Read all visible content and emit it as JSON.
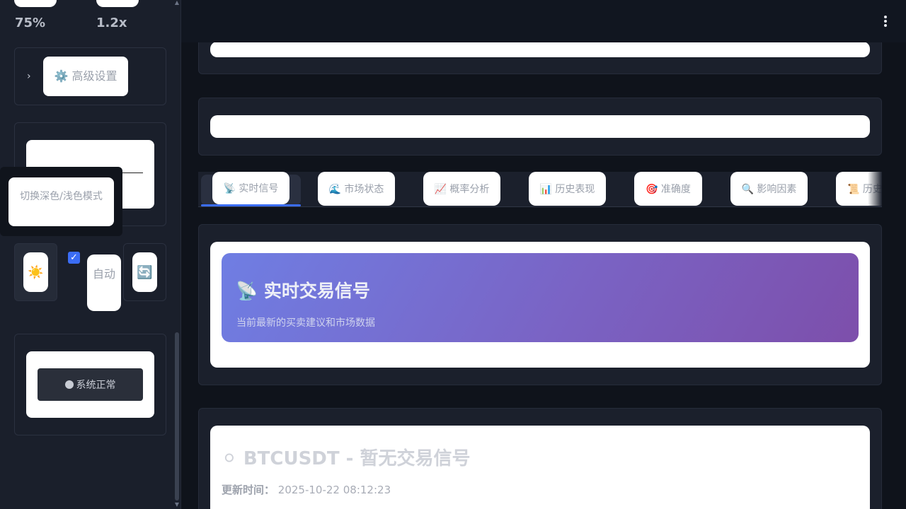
{
  "sidebar": {
    "metrics": [
      {
        "value": "75%"
      },
      {
        "value": "1.2x"
      }
    ],
    "advanced_settings": {
      "icon": "gear-icon",
      "label": "⚙️ 高级设置"
    },
    "theme_toggle": {
      "tooltip": "切换深色/浅色模式",
      "icon": "☀️"
    },
    "auto_refresh": {
      "checked": true,
      "label": "自动",
      "refresh_icon": "🔄"
    },
    "system_status": {
      "label": "系统正常",
      "dot_color": "#c8ccd4"
    }
  },
  "tabs": [
    {
      "label": "📡 实时信号",
      "active": true
    },
    {
      "label": "🌊 市场状态"
    },
    {
      "label": "📈 概率分析"
    },
    {
      "label": "📊 历史表现"
    },
    {
      "label": "🎯 准确度"
    },
    {
      "label": "🔍 影响因素"
    },
    {
      "label": "📜 历史"
    }
  ],
  "hero": {
    "title": "📡 实时交易信号",
    "subtitle": "当前最新的买卖建议和市场数据"
  },
  "signal": {
    "title": "⚪ BTCUSDT - 暂无交易信号",
    "update_label": "更新时间：",
    "update_time": "2025-10-22 08:12:23"
  },
  "colors": {
    "accent": "#3b6df5",
    "hero_gradient_start": "#6f7ee3",
    "hero_gradient_end": "#7d4fab",
    "background": "#0f131b",
    "sidebar": "#1a1f2b"
  }
}
